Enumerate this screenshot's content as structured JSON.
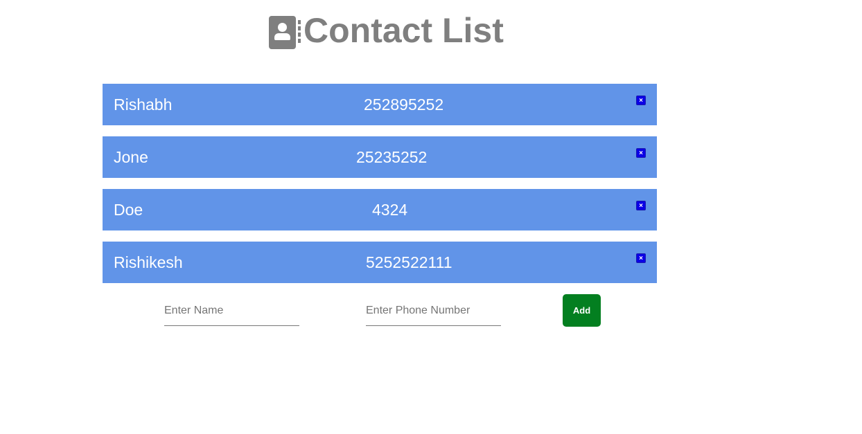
{
  "header": {
    "icon": "contact-book-icon",
    "title": "Contact List"
  },
  "contacts": [
    {
      "name": "Rishabh",
      "phone": "252895252"
    },
    {
      "name": "Jone",
      "phone": "25235252"
    },
    {
      "name": "Doe",
      "phone": "4324"
    },
    {
      "name": "Rishikesh",
      "phone": "5252522111"
    }
  ],
  "delete_icon": {
    "glyph": "×",
    "name": "close-icon"
  },
  "form": {
    "name_placeholder": "Enter Name",
    "name_value": "",
    "phone_placeholder": "Enter Phone Number",
    "phone_value": "",
    "add_label": "Add"
  },
  "colors": {
    "row_bg": "#6194e8",
    "delete_bg": "#0a00e6",
    "add_bg": "#037f20",
    "title": "#7f7f7f"
  }
}
